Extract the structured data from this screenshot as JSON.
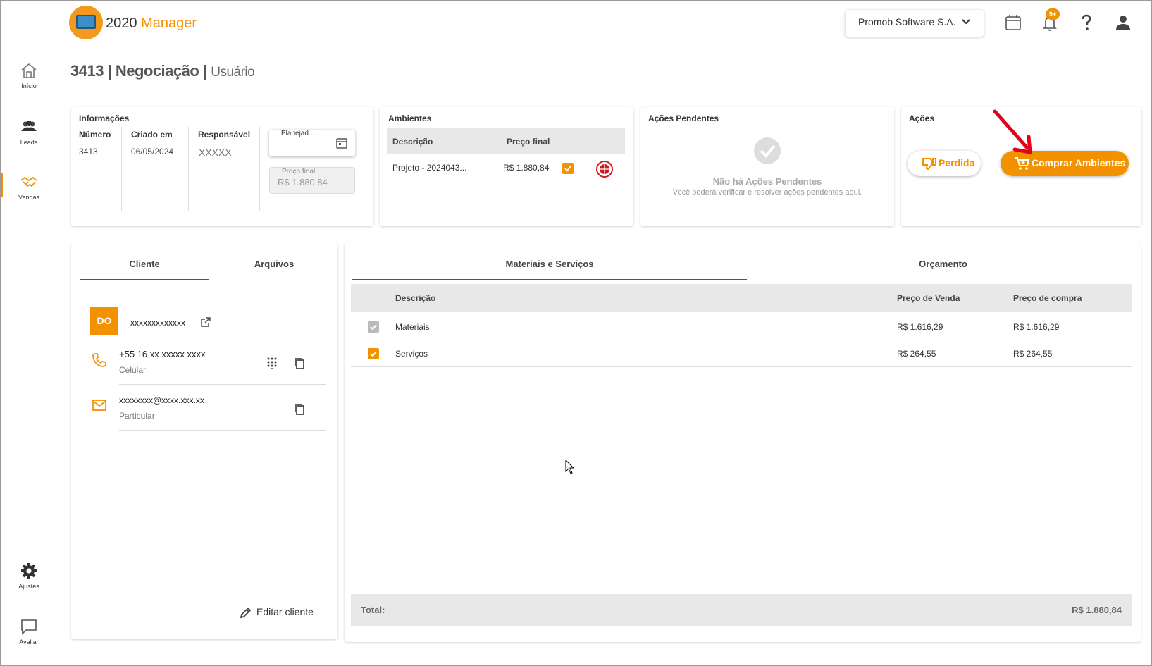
{
  "header": {
    "app_name_prefix": "2020",
    "app_name_suffix": "Manager",
    "company": "Promob Software S.A.",
    "notifications_badge": "9+"
  },
  "sidebar": {
    "items": [
      {
        "label": "Início"
      },
      {
        "label": "Leads"
      },
      {
        "label": "Vendas"
      },
      {
        "label": "Ajustes"
      },
      {
        "label": "Avaliar"
      }
    ]
  },
  "page": {
    "title": "3413 | Negociação |",
    "subtitle": "Usuário"
  },
  "info": {
    "title": "Informações",
    "numero_label": "Número",
    "numero_value": "3413",
    "criado_label": "Criado em",
    "criado_value": "06/05/2024",
    "responsavel_label": "Responsável",
    "responsavel_value": "XXXXX",
    "planejado_label": "Planejad...",
    "preco_final_label": "Preço final",
    "preco_final_value": "R$ 1.880,84"
  },
  "ambientes": {
    "title": "Ambientes",
    "col_descricao": "Descrição",
    "col_preco": "Preço final",
    "rows": [
      {
        "descricao": "Projeto - 2024043...",
        "preco": "R$ 1.880,84"
      }
    ]
  },
  "pendentes": {
    "title": "Ações Pendentes",
    "empty_title": "Não há Ações Pendentes",
    "empty_sub": "Você poderá verificar e resolver ações pendentes aqui."
  },
  "acoes": {
    "title": "Ações",
    "perdida_label": "Perdida",
    "comprar_label": "Comprar Ambientes"
  },
  "left_tabs": [
    "Cliente",
    "Arquivos"
  ],
  "cliente": {
    "initials": "DO",
    "name": "xxxxxxxxxxxxx",
    "phone": "+55 16  xx xxxxx xxxx",
    "phone_type": "Celular",
    "email": "xxxxxxxx@xxxx.xxx.xx",
    "email_type": "Particular",
    "edit_label": "Editar cliente"
  },
  "right_tabs": [
    "Materiais e Serviços",
    "Orçamento"
  ],
  "materiais": {
    "col_descricao": "Descrição",
    "col_venda": "Preço de Venda",
    "col_compra": "Preço de compra",
    "rows": [
      {
        "descricao": "Materiais",
        "venda": "R$ 1.616,29",
        "compra": "R$ 1.616,29"
      },
      {
        "descricao": "Serviços",
        "venda": "R$ 264,55",
        "compra": "R$ 264,55"
      }
    ],
    "total_label": "Total:",
    "total_value": "R$ 1.880,84"
  },
  "colors": {
    "accent": "#f39200",
    "annotation_arrow": "#e3001b"
  }
}
